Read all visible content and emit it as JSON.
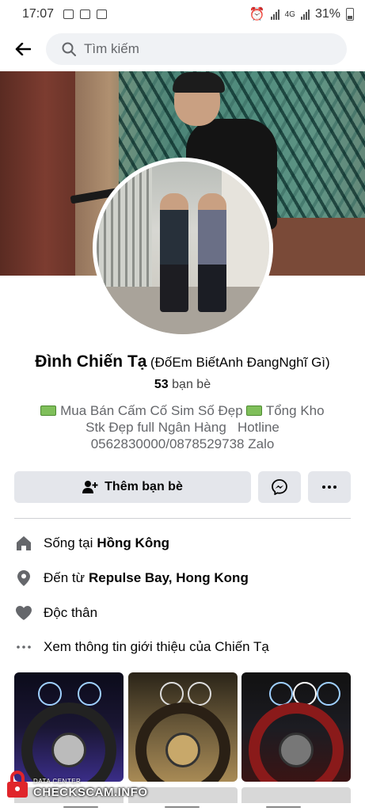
{
  "status_bar": {
    "time": "17:07",
    "network": "4G",
    "battery": "31%"
  },
  "search": {
    "placeholder": "Tìm kiếm"
  },
  "profile": {
    "name": "Đình Chiến Tạ",
    "alternate_name": "(ĐốEm BiếtAnh ĐangNghĩ Gì)",
    "friends_count": "53",
    "friends_label": "bạn bè",
    "bio_lines": [
      "Mua Bán Cấm Cố Sim Số Đẹp",
      "Tổng Kho",
      "Stk Đẹp full Ngân Hàng   Hotline",
      "0562830000/0878529738 Zalo"
    ]
  },
  "actions": {
    "add_friend_label": "Thêm bạn bè"
  },
  "details": {
    "lives_in_prefix": "Sống tại",
    "lives_in_value": "Hồng Kông",
    "from_prefix": "Đến từ",
    "from_value": "Repulse Bay, Hong Kong",
    "relationship": "Độc thân",
    "see_about": "Xem thông tin giới thiệu của Chiến Tạ"
  },
  "watermark": {
    "small": "DATA CENTER",
    "big": "CHECKSCAM.INFO"
  },
  "colors": {
    "button_bg": "#e4e6eb",
    "search_bg": "#f0f2f5",
    "secondary_text": "#65676b",
    "watermark_lock": "#e0252b"
  }
}
